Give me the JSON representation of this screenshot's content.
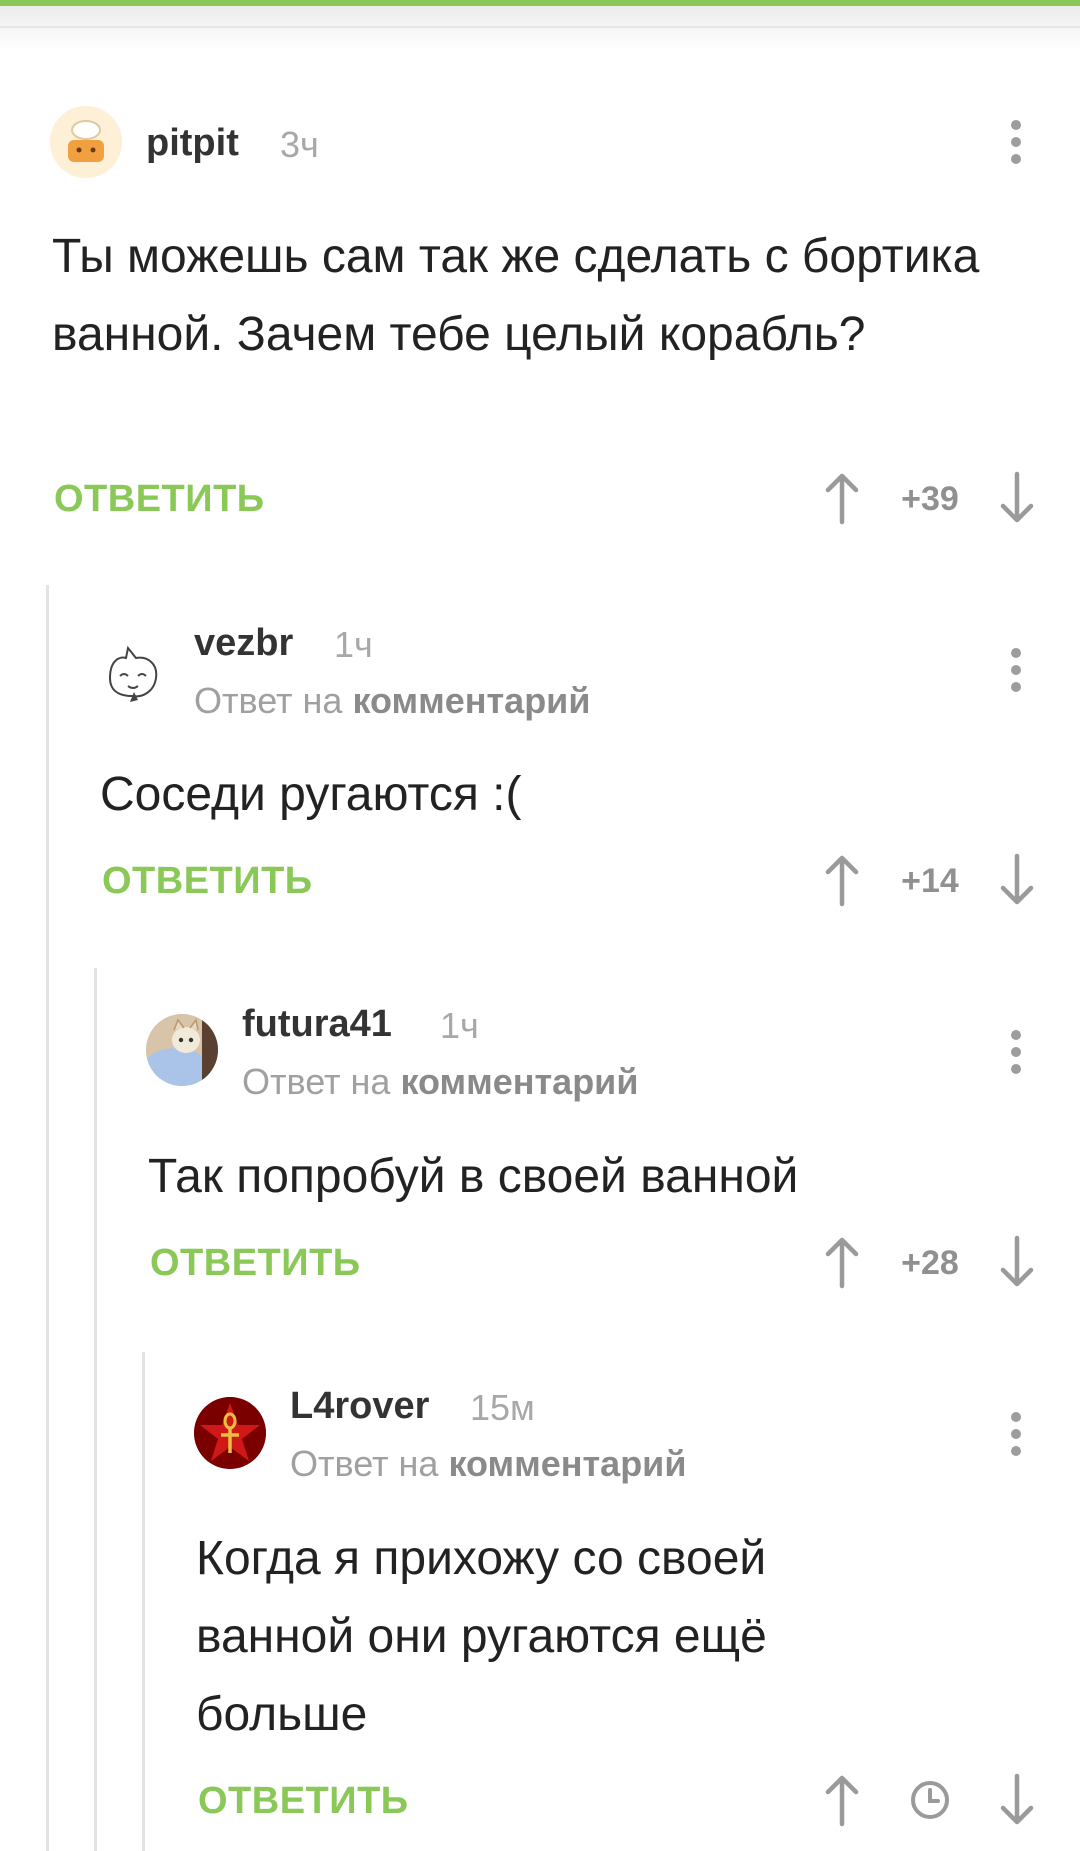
{
  "colors": {
    "accent": "#8ac858",
    "muted": "#a8a8a8",
    "text": "#222222"
  },
  "comments": [
    {
      "username": "pitpit",
      "time": "3ч",
      "text": "Ты можешь сам так же сделать с бортика ванной. Зачем тебе целый корабль?",
      "reply_label": "ОТВЕТИТЬ",
      "score": "+39",
      "avatar_icon": "chef-cat-avatar"
    },
    {
      "username": "vezbr",
      "time": "1ч",
      "reply_prefix": "Ответ на",
      "reply_target": "комментарий",
      "text": "Соседи ругаются :(",
      "reply_label": "ОТВЕТИТЬ",
      "score": "+14",
      "avatar_icon": "cat-sketch-avatar"
    },
    {
      "username": "futura41",
      "time": "1ч",
      "reply_prefix": "Ответ на",
      "reply_target": "комментарий",
      "text": "Так попробуй в своей ванной",
      "reply_label": "ОТВЕТИТЬ",
      "score": "+28",
      "avatar_icon": "cat-photo-avatar"
    },
    {
      "username": "L4rover",
      "time": "15м",
      "reply_prefix": "Ответ на",
      "reply_target": "комментарий",
      "text": "Когда я прихожу со своей ванной они ругаются ещё больше",
      "reply_label": "ОТВЕТИТЬ",
      "score_icon": "clock-icon",
      "avatar_icon": "ankh-star-avatar"
    }
  ]
}
